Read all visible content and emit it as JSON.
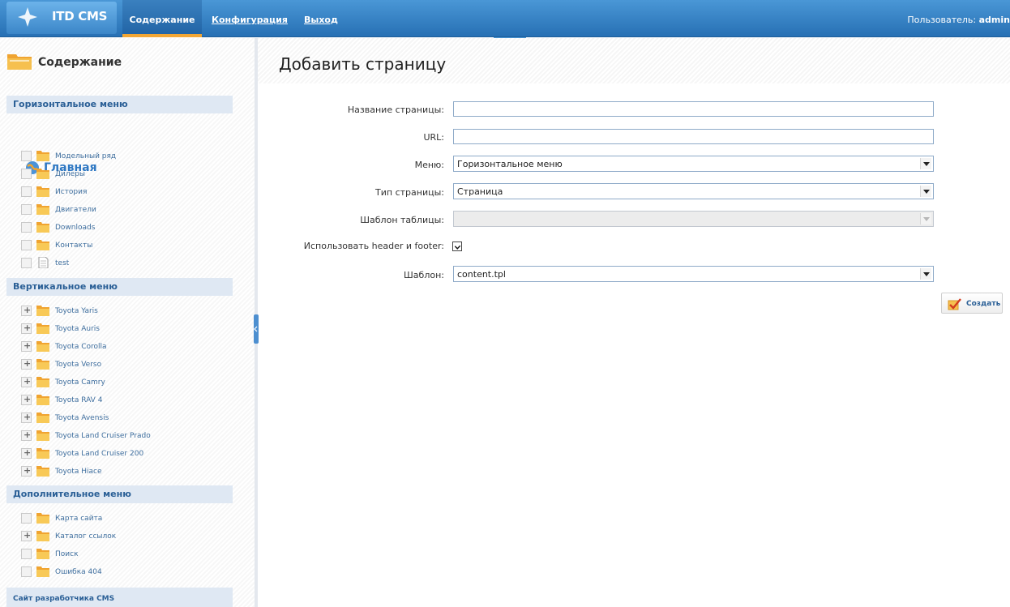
{
  "app": {
    "title": "ITD CMS"
  },
  "nav": {
    "items": [
      {
        "label": "Содержание"
      },
      {
        "label": "Конфигурация"
      },
      {
        "label": "Выход"
      }
    ]
  },
  "user": {
    "label": "Пользователь:",
    "name": "admin"
  },
  "sidebar": {
    "title": "Содержание",
    "sections": {
      "horizontal": "Горизонтальное меню",
      "vertical": "Вертикальное меню",
      "additional": "Дополнительное меню"
    },
    "home": "Главная",
    "horizontal_items": [
      "Модельный ряд",
      "Дилеры",
      "История",
      "Двигатели",
      "Downloads",
      "Контакты",
      "test"
    ],
    "vertical_items": [
      "Toyota Yaris",
      "Toyota Auris",
      "Toyota Corolla",
      "Toyota Verso",
      "Toyota Camry",
      "Toyota RAV 4",
      "Toyota Avensis",
      "Toyota Land Cruiser Prado",
      "Toyota Land Cruiser 200",
      "Toyota Hiace"
    ],
    "additional_items": [
      "Карта сайта",
      "Каталог ссылок",
      "Поиск",
      "Ошибка 404"
    ],
    "footer": "Сайт разработчика CMS"
  },
  "page": {
    "title": "Добавить страницу",
    "form": {
      "name_label": "Название страницы:",
      "name_value": "",
      "url_label": "URL:",
      "url_value": "",
      "menu_label": "Меню:",
      "menu_value": "Горизонтальное меню",
      "type_label": "Тип страницы:",
      "type_value": "Страница",
      "table_template_label": "Шаблон таблицы:",
      "table_template_value": "",
      "header_footer_label": "Использовать header и footer:",
      "header_footer_checked": true,
      "template_label": "Шаблон:",
      "template_value": "content.tpl",
      "submit_label": "Создать"
    }
  }
}
